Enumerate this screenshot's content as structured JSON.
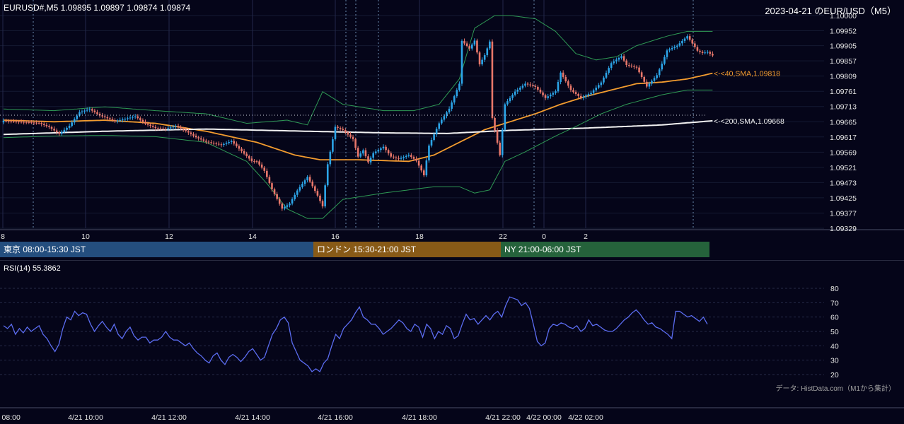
{
  "header": {
    "symbol_line": "EURUSD#,M5 1.09895 1.09897 1.09874 1.09874",
    "title_right": "2023-04-21 のEUR/USD（M5）"
  },
  "chart_data": [
    {
      "type": "candlestick",
      "title": "2023-04-21 のEUR/USD（M5）",
      "symbol": "EURUSD#",
      "timeframe": "M5",
      "ohlc_last": [
        1.09895,
        1.09897,
        1.09874,
        1.09874
      ],
      "y_ticks": [
        "1.10000",
        "1.09952",
        "1.09905",
        "1.09857",
        "1.09809",
        "1.09761",
        "1.09713",
        "1.09665",
        "1.09617",
        "1.09569",
        "1.09521",
        "1.09473",
        "1.09425",
        "1.09377",
        "1.09329"
      ],
      "ylim": [
        1.09329,
        1.1
      ],
      "x_ticks": [
        "8",
        "10",
        "12",
        "14",
        "16",
        "18",
        "22",
        "0",
        "2"
      ],
      "close_path": [
        [
          0,
          1.09668
        ],
        [
          8,
          1.09664
        ],
        [
          14,
          1.09661
        ],
        [
          18,
          1.09648
        ],
        [
          22,
          1.09627
        ],
        [
          26,
          1.09652
        ],
        [
          30,
          1.09695
        ],
        [
          34,
          1.09705
        ],
        [
          38,
          1.09685
        ],
        [
          44,
          1.09667
        ],
        [
          48,
          1.09674
        ],
        [
          52,
          1.09682
        ],
        [
          56,
          1.09659
        ],
        [
          60,
          1.09645
        ],
        [
          64,
          1.09642
        ],
        [
          68,
          1.09652
        ],
        [
          72,
          1.09636
        ],
        [
          76,
          1.09616
        ],
        [
          80,
          1.09602
        ],
        [
          86,
          1.09592
        ],
        [
          90,
          1.09604
        ],
        [
          94,
          1.09572
        ],
        [
          98,
          1.09541
        ],
        [
          100,
          1.0954
        ],
        [
          103,
          1.0951
        ],
        [
          106,
          1.09452
        ],
        [
          110,
          1.09391
        ],
        [
          113,
          1.09407
        ],
        [
          116,
          1.09448
        ],
        [
          120,
          1.09491
        ],
        [
          124,
          1.09432
        ],
        [
          126,
          1.09398
        ],
        [
          128,
          1.09531
        ],
        [
          131,
          1.09649
        ],
        [
          134,
          1.09639
        ],
        [
          138,
          1.0961
        ],
        [
          140,
          1.09555
        ],
        [
          142,
          1.09575
        ],
        [
          144,
          1.09537
        ],
        [
          146,
          1.09566
        ],
        [
          150,
          1.09586
        ],
        [
          153,
          1.09555
        ],
        [
          156,
          1.09548
        ],
        [
          160,
          1.0956
        ],
        [
          163,
          1.09542
        ],
        [
          166,
          1.09496
        ],
        [
          168,
          1.0959
        ],
        [
          172,
          1.0966
        ],
        [
          176,
          1.09706
        ],
        [
          180,
          1.09785
        ],
        [
          181,
          1.0992
        ],
        [
          184,
          1.09896
        ],
        [
          186,
          1.09921
        ],
        [
          188,
          1.09846
        ],
        [
          190,
          1.09875
        ],
        [
          192,
          1.09918
        ],
        [
          193,
          1.09677
        ],
        [
          196,
          1.0956
        ],
        [
          198,
          1.0972
        ],
        [
          202,
          1.0976
        ],
        [
          206,
          1.09785
        ],
        [
          210,
          1.09775
        ],
        [
          214,
          1.0974
        ],
        [
          218,
          1.09761
        ],
        [
          220,
          1.0982
        ],
        [
          224,
          1.09765
        ],
        [
          228,
          1.0974
        ],
        [
          232,
          1.09756
        ],
        [
          236,
          1.09789
        ],
        [
          240,
          1.0985
        ],
        [
          244,
          1.09872
        ],
        [
          246,
          1.09844
        ],
        [
          250,
          1.09836
        ],
        [
          254,
          1.09776
        ],
        [
          258,
          1.09812
        ],
        [
          260,
          1.09848
        ],
        [
          262,
          1.0989
        ],
        [
          266,
          1.09905
        ],
        [
          270,
          1.09935
        ],
        [
          274,
          1.09889
        ],
        [
          276,
          1.09882
        ],
        [
          278,
          1.09885
        ],
        [
          280,
          1.09874
        ]
      ],
      "series": [
        {
          "name": "40,SMA",
          "last_value": 1.09818,
          "color": "#f39c2f",
          "path": [
            [
              0,
              1.0967
            ],
            [
              20,
              1.09665
            ],
            [
              40,
              1.0967
            ],
            [
              60,
              1.0966
            ],
            [
              80,
              1.09635
            ],
            [
              100,
              1.096
            ],
            [
              115,
              1.0956
            ],
            [
              125,
              1.09545
            ],
            [
              140,
              1.09545
            ],
            [
              160,
              1.0954
            ],
            [
              170,
              1.0956
            ],
            [
              180,
              1.096
            ],
            [
              190,
              1.0964
            ],
            [
              200,
              1.09665
            ],
            [
              210,
              1.0969
            ],
            [
              220,
              1.0972
            ],
            [
              230,
              1.09745
            ],
            [
              240,
              1.09765
            ],
            [
              250,
              1.09785
            ],
            [
              260,
              1.0979
            ],
            [
              270,
              1.098
            ],
            [
              280,
              1.09818
            ]
          ]
        },
        {
          "name": "200,SMA",
          "last_value": 1.09668,
          "color": "#f2f2f2",
          "path": [
            [
              0,
              1.09625
            ],
            [
              40,
              1.09635
            ],
            [
              80,
              1.09642
            ],
            [
              120,
              1.09635
            ],
            [
              150,
              1.0963
            ],
            [
              175,
              1.09628
            ],
            [
              200,
              1.09638
            ],
            [
              230,
              1.09645
            ],
            [
              260,
              1.09655
            ],
            [
              280,
              1.09668
            ]
          ]
        },
        {
          "name": "BB upper",
          "color": "#2f9a55",
          "path": [
            [
              0,
              1.09705
            ],
            [
              20,
              1.097
            ],
            [
              40,
              1.09712
            ],
            [
              60,
              1.097
            ],
            [
              80,
              1.0969
            ],
            [
              96,
              1.0966
            ],
            [
              104,
              1.09665
            ],
            [
              112,
              1.0967
            ],
            [
              120,
              1.09655
            ],
            [
              126,
              1.0976
            ],
            [
              134,
              1.0972
            ],
            [
              150,
              1.097
            ],
            [
              162,
              1.097
            ],
            [
              172,
              1.0972
            ],
            [
              180,
              1.098
            ],
            [
              186,
              1.0996
            ],
            [
              194,
              1.1
            ],
            [
              200,
              1.1
            ],
            [
              210,
              1.0999
            ],
            [
              218,
              1.0995
            ],
            [
              226,
              1.0988
            ],
            [
              234,
              1.0986
            ],
            [
              242,
              1.0987
            ],
            [
              250,
              1.09905
            ],
            [
              262,
              1.09935
            ],
            [
              270,
              1.0995
            ],
            [
              280,
              1.0995
            ]
          ]
        },
        {
          "name": "BB lower",
          "color": "#2f9a55",
          "path": [
            [
              0,
              1.09615
            ],
            [
              20,
              1.0962
            ],
            [
              40,
              1.09622
            ],
            [
              60,
              1.09618
            ],
            [
              80,
              1.096
            ],
            [
              96,
              1.0954
            ],
            [
              104,
              1.0947
            ],
            [
              112,
              1.0939
            ],
            [
              120,
              1.0936
            ],
            [
              126,
              1.0936
            ],
            [
              134,
              1.0942
            ],
            [
              150,
              1.0944
            ],
            [
              160,
              1.0945
            ],
            [
              170,
              1.0946
            ],
            [
              180,
              1.0946
            ],
            [
              186,
              1.0944
            ],
            [
              192,
              1.0945
            ],
            [
              198,
              1.0954
            ],
            [
              206,
              1.0957
            ],
            [
              218,
              1.0962
            ],
            [
              226,
              1.0965
            ],
            [
              236,
              1.0969
            ],
            [
              246,
              1.0972
            ],
            [
              260,
              1.0975
            ],
            [
              270,
              1.09765
            ],
            [
              280,
              1.09765
            ]
          ]
        }
      ],
      "annotations": [
        "<-<40,SMA,1.09818",
        "<-<200,SMA,1.09668"
      ]
    },
    {
      "type": "line",
      "title": "RSI(14) 55.3862",
      "ylim": [
        20,
        80
      ],
      "y_ticks": [
        "80",
        "70",
        "60",
        "50",
        "40",
        "30",
        "20"
      ],
      "x_ticks": [
        "4/21 08:00",
        "4/21 10:00",
        "4/21 12:00",
        "4/21 14:00",
        "4/21 16:00",
        "4/21 18:00",
        "4/21 22:00",
        "4/22 00:00",
        "4/22 02:00"
      ],
      "series": [
        {
          "name": "RSI(14)",
          "color": "#5b6cf0",
          "values": [
            54,
            52,
            55,
            48,
            52,
            49,
            53,
            50,
            52,
            54,
            48,
            45,
            40,
            36,
            41,
            52,
            60,
            58,
            64,
            61,
            63,
            62,
            55,
            50,
            54,
            57,
            53,
            50,
            55,
            48,
            45,
            50,
            53,
            47,
            44,
            46,
            46,
            42,
            44,
            44,
            46,
            50,
            46,
            44,
            44,
            42,
            40,
            42,
            38,
            35,
            33,
            30,
            28,
            33,
            35,
            30,
            27,
            32,
            34,
            32,
            29,
            32,
            36,
            38,
            34,
            30,
            32,
            40,
            48,
            52,
            58,
            60,
            56,
            42,
            36,
            30,
            28,
            26,
            22,
            24,
            22,
            28,
            31,
            40,
            48,
            45,
            52,
            55,
            58,
            63,
            67,
            60,
            58,
            55,
            55,
            52,
            48,
            50,
            52,
            55,
            58,
            56,
            52,
            50,
            55,
            53,
            46,
            55,
            52,
            45,
            50,
            48,
            54,
            52,
            45,
            47,
            55,
            62,
            58,
            59,
            55,
            58,
            61,
            58,
            62,
            64,
            60,
            68,
            74,
            73,
            72,
            68,
            70,
            66,
            55,
            43,
            40,
            42,
            52,
            55,
            54,
            56,
            55,
            53,
            52,
            54,
            50,
            52,
            58,
            54,
            55,
            53,
            51,
            50,
            50,
            52,
            55,
            58,
            60,
            63,
            65,
            62,
            58,
            55,
            56,
            53,
            52,
            50,
            48,
            45,
            64,
            64,
            62,
            60,
            61,
            59,
            57,
            60,
            55
          ]
        }
      ]
    }
  ],
  "sessions": [
    {
      "label": "東京 08:00-15:30 JST",
      "color": "#244e7e"
    },
    {
      "label": "ロンドン 15:30-21:00 JST",
      "color": "#885a17"
    },
    {
      "label": "NY 21:00-06:00 JST",
      "color": "#25623b"
    }
  ],
  "footer": {
    "credit": "データ: HistData.com（M1から集計）"
  },
  "colors": {
    "background": "#050519",
    "bull": "#2ca5e8",
    "bear": "#e8776a",
    "sma40": "#f39c2f",
    "sma200": "#f2f2f2",
    "bollinger": "#2f9a55",
    "rsi": "#5b6cf0"
  }
}
